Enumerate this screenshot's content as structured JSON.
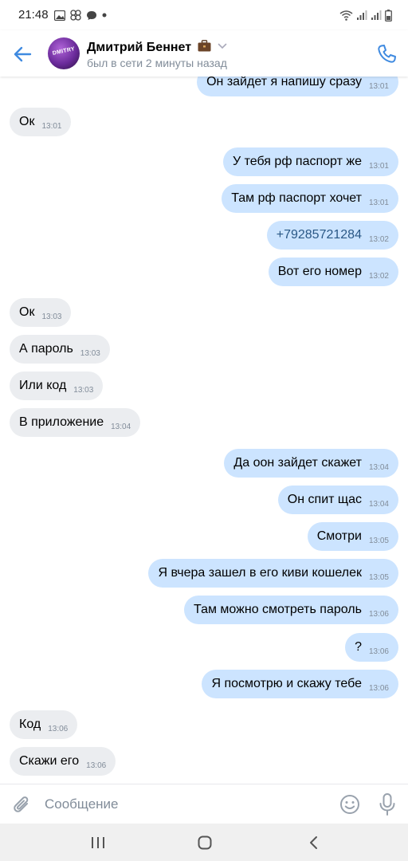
{
  "status_bar": {
    "time": "21:48"
  },
  "header": {
    "name": "Дмитрий Беннет",
    "status": "был в сети 2 минуты назад",
    "avatar_text": "DMITRY"
  },
  "messages": [
    {
      "dir": "out",
      "text": "Он зайдет я напишу сразу",
      "time": "13:01"
    },
    {
      "dir": "in",
      "text": "Ок",
      "time": "13:01"
    },
    {
      "dir": "out",
      "text": "У тебя рф паспорт же",
      "time": "13:01"
    },
    {
      "dir": "out",
      "text": "Там рф паспорт хочет",
      "time": "13:01"
    },
    {
      "dir": "out",
      "text": "+79285721284",
      "time": "13:02",
      "link": true
    },
    {
      "dir": "out",
      "text": "Вот его номер",
      "time": "13:02"
    },
    {
      "dir": "in",
      "text": "Ок",
      "time": "13:03"
    },
    {
      "dir": "in",
      "text": "А пароль",
      "time": "13:03"
    },
    {
      "dir": "in",
      "text": "Или код",
      "time": "13:03"
    },
    {
      "dir": "in",
      "text": "В приложение",
      "time": "13:04"
    },
    {
      "dir": "out",
      "text": "Да оон зайдет скажет",
      "time": "13:04"
    },
    {
      "dir": "out",
      "text": "Он спит щас",
      "time": "13:04"
    },
    {
      "dir": "out",
      "text": "Смотри",
      "time": "13:05"
    },
    {
      "dir": "out",
      "text": "Я вчера зашел в его киви кошелек",
      "time": "13:05"
    },
    {
      "dir": "out",
      "text": "Там можно смотреть пароль",
      "time": "13:06"
    },
    {
      "dir": "out",
      "text": "?",
      "time": "13:06"
    },
    {
      "dir": "out",
      "text": "Я посмотрю и скажу тебе",
      "time": "13:06"
    },
    {
      "dir": "in",
      "text": "Код",
      "time": "13:06"
    },
    {
      "dir": "in",
      "text": "Скажи его",
      "time": "13:06"
    }
  ],
  "composer": {
    "placeholder": "Сообщение"
  },
  "colors": {
    "accent": "#3f8ae0",
    "incoming_bubble": "#ebedf0",
    "outgoing_bubble": "#cce4ff",
    "secondary_text": "#818c99",
    "link": "#2a5885"
  },
  "icons": {
    "back": "arrow-left-icon",
    "call": "phone-icon",
    "attach": "paperclip-icon",
    "emoji": "smile-icon",
    "mic": "microphone-icon"
  }
}
